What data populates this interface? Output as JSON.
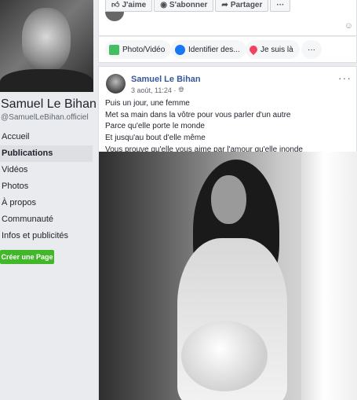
{
  "page": {
    "name": "Samuel Le Bihan",
    "handle": "@SamuelLeBihan.officiel"
  },
  "nav": {
    "items": [
      {
        "label": "Accueil"
      },
      {
        "label": "Publications"
      },
      {
        "label": "Vidéos"
      },
      {
        "label": "Photos"
      },
      {
        "label": "À propos"
      },
      {
        "label": "Communauté"
      },
      {
        "label": "Infos et publicités"
      }
    ],
    "active_index": 1,
    "create_button": "Créer une Page"
  },
  "action_bar": {
    "like": "J'aime",
    "subscribe": "S'abonner",
    "share": "Partager",
    "more": "···"
  },
  "composer": {
    "photo_video": "Photo/Vidéo",
    "tag_people": "Identifier des...",
    "check_in": "Je suis là",
    "more": "···"
  },
  "post": {
    "author": "Samuel Le Bihan",
    "date": "3 août, 11:24 ·",
    "menu": "···",
    "lines": [
      "Puis un jour, une femme",
      "Met sa main dans la vôtre pour vous parler d'un autre",
      "Parce qu'elle porte le monde",
      "Et jusqu'au bout d'elle même",
      "Vous prouve qu'elle vous aime par l'amour qu'elle inonde"
    ]
  },
  "colors": {
    "link": "#385898",
    "create_button": "#42b72a",
    "verified": "#4267b2"
  },
  "icons": {
    "like": "thumbs-up-icon",
    "subscribe": "rss-icon",
    "share": "share-icon",
    "photo": "photo-icon",
    "tag": "tag-people-icon",
    "checkin": "location-pin-icon",
    "globe": "globe-icon",
    "verified": "verified-badge-icon",
    "emoji": "emoji-icon"
  }
}
